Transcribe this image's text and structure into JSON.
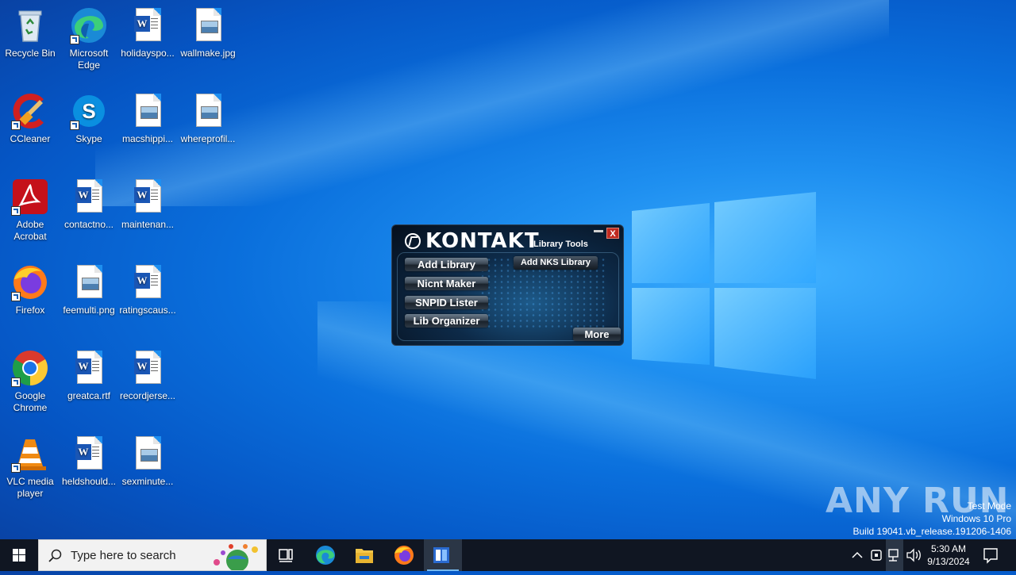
{
  "desktop": {
    "icons": [
      {
        "label": "Recycle Bin"
      },
      {
        "label": "Microsoft Edge"
      },
      {
        "label": "holidayspo..."
      },
      {
        "label": "wallmake.jpg"
      },
      {
        "label": "CCleaner"
      },
      {
        "label": "Skype"
      },
      {
        "label": "macshippi..."
      },
      {
        "label": "whereprofil..."
      },
      {
        "label": "Adobe Acrobat"
      },
      {
        "label": "contactno..."
      },
      {
        "label": "maintenan..."
      },
      {
        "label": "Firefox"
      },
      {
        "label": "feemulti.png"
      },
      {
        "label": "ratingscaus..."
      },
      {
        "label": "Google Chrome"
      },
      {
        "label": "greatca.rtf"
      },
      {
        "label": "recordjerse..."
      },
      {
        "label": "VLC media player"
      },
      {
        "label": "heldshould..."
      },
      {
        "label": "sexminute..."
      }
    ]
  },
  "kontakt_window": {
    "logo_text": "KONTAKT",
    "subtitle": "Library Tools",
    "close_label": "X",
    "buttons": {
      "add_library": "Add Library",
      "add_nks_library": "Add NKS Library",
      "nicnt_maker": "Nicnt Maker",
      "snpid_lister": "SNPID Lister",
      "lib_organizer": "Lib Organizer",
      "more": "More"
    }
  },
  "watermark": {
    "brand": "ANY RUN",
    "test_mode": "Test Mode",
    "edition": "Windows 10 Pro",
    "build": "Build 19041.vb_release.191206-1406"
  },
  "taskbar": {
    "search_placeholder": "Type here to search",
    "clock_time": "5:30 AM",
    "clock_date": "9/13/2024",
    "pinned": [
      "task-view-icon",
      "edge-icon",
      "file-explorer-icon",
      "firefox-icon",
      "kontakt-app-icon"
    ]
  },
  "colors": {
    "taskbar_bg": "#101622",
    "accent": "#76b9ed",
    "desktop_blue": "#0a6fdc"
  }
}
